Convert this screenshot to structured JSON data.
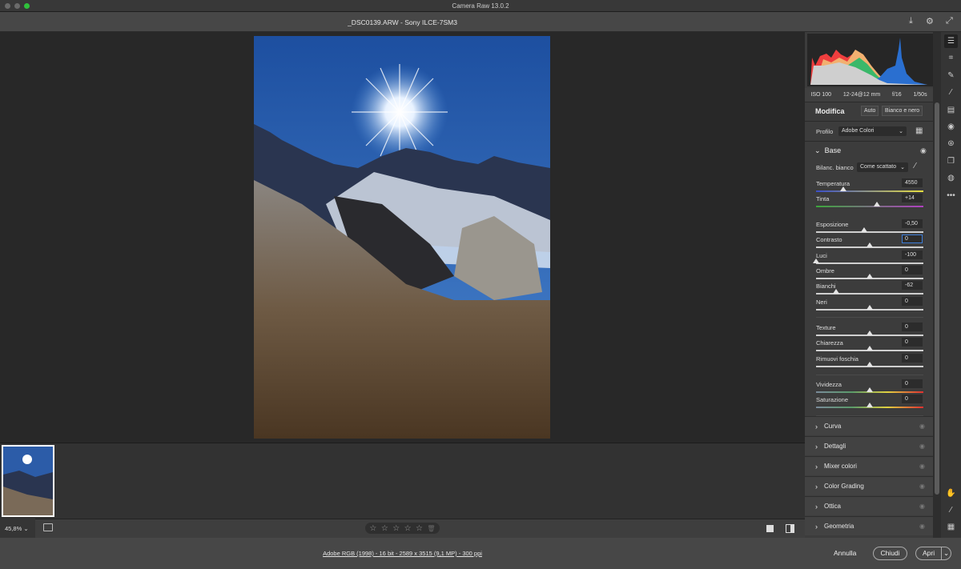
{
  "window": {
    "title": "Camera Raw 13.0.2",
    "file_title": "_DSC0139.ARW  -  Sony ILCE-7SM3"
  },
  "colors": {
    "accent": "#3d7dd8",
    "panel": "#3c3c3c",
    "canvas": "#282828",
    "close_dot": "#6a6a6a",
    "zoom_dot": "#2fc13b"
  },
  "exif": [
    "ISO 100",
    "12-24@12 mm",
    "f/16",
    "1/50s"
  ],
  "edit": {
    "title": "Modifica",
    "auto": "Auto",
    "bw": "Bianco e nero",
    "profile_label": "Profilo",
    "profile_value": "Adobe Colori"
  },
  "base": {
    "title": "Base",
    "wb_label": "Bilanc. bianco",
    "wb_value": "Come scattato"
  },
  "sliders": [
    {
      "label": "Temperatura",
      "value": "4550",
      "level": 0.25,
      "style": "temp"
    },
    {
      "label": "Tinta",
      "value": "+14",
      "level": 0.57,
      "style": "tint"
    },
    {
      "label": "Esposizione",
      "value": "-0,50",
      "level": 0.45
    },
    {
      "label": "Contrasto",
      "value": "0",
      "level": 0.5,
      "focused": true
    },
    {
      "label": "Luci",
      "value": "-100",
      "level": 0
    },
    {
      "label": "Ombre",
      "value": "0",
      "level": 0.5
    },
    {
      "label": "Bianchi",
      "value": "-62",
      "level": 0.19
    },
    {
      "label": "Neri",
      "value": "0",
      "level": 0.5
    },
    {
      "label": "Texture",
      "value": "0",
      "level": 0.5
    },
    {
      "label": "Chiarezza",
      "value": "0",
      "level": 0.5
    },
    {
      "label": "Rimuovi foschia",
      "value": "0",
      "level": 0.5
    },
    {
      "label": "Vividezza",
      "value": "0",
      "level": 0.5,
      "style": "sat"
    },
    {
      "label": "Saturazione",
      "value": "0",
      "level": 0.5,
      "style": "sat"
    }
  ],
  "sections": [
    "Curva",
    "Dettagli",
    "Mixer colori",
    "Color Grading",
    "Ottica",
    "Geometria"
  ],
  "bottom": {
    "zoom": "45,8%",
    "rating_stars": 5,
    "rating_value": 0,
    "info": "Adobe RGB (1998) - 16 bit - 2589 x 3515 (9,1 MP) - 300 ppi"
  },
  "footer": {
    "cancel": "Annulla",
    "close": "Chiudi",
    "open": "Apri"
  },
  "tools": [
    {
      "icon": "sliders-icon",
      "glyph": "☰"
    },
    {
      "icon": "crop-icon",
      "glyph": "⌗"
    },
    {
      "icon": "healing-icon",
      "glyph": "✎"
    },
    {
      "icon": "brush-icon",
      "glyph": "⁄"
    },
    {
      "icon": "gradient-icon",
      "glyph": "▤"
    },
    {
      "icon": "radial-filter-icon",
      "glyph": "◉"
    },
    {
      "icon": "red-eye-icon",
      "glyph": "⊛"
    },
    {
      "icon": "snapshots-icon",
      "glyph": "❐"
    },
    {
      "icon": "presets-icon",
      "glyph": "◍"
    },
    {
      "icon": "more-icon",
      "glyph": "•••"
    }
  ],
  "bottom_tools": [
    {
      "icon": "hand-icon",
      "glyph": "✋"
    },
    {
      "icon": "color-sampler-icon",
      "glyph": "⁄"
    },
    {
      "icon": "grid-icon",
      "glyph": "▦"
    }
  ]
}
